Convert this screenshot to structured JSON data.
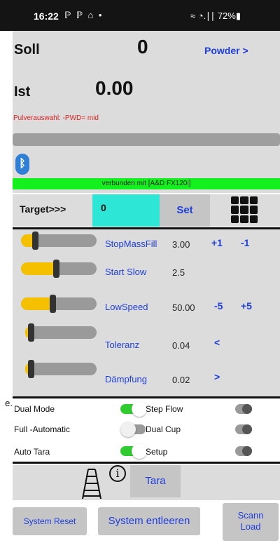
{
  "status_bar": {
    "time": "16:22",
    "notification_icons": "ℙ ℙ ⌂ •",
    "system": "≈ ◔.∣∣ 72%▮"
  },
  "header": {
    "soll_label": "Soll",
    "soll_value": "0",
    "powder_link": "Powder >",
    "ist_label": "Ist",
    "ist_value": "0.00",
    "pwd_text": "Pulverauswahl: -PWD= mid"
  },
  "progress": {
    "fraction": 0.0
  },
  "connection": {
    "bluetooth_glyph": "ᛒ",
    "status_text": "verbunden mit [A&D FX120i]"
  },
  "target": {
    "label": "Target>>>",
    "value": "0",
    "set_label": "Set"
  },
  "params": [
    {
      "name": "StopMassFill",
      "value": "3.00",
      "btn1": "+1",
      "btn2": "-1",
      "level": 0.1
    },
    {
      "name": "Start Slow",
      "value": "2.5",
      "btn1": "",
      "btn2": "",
      "level": 0.45
    },
    {
      "name": "LowSpeed",
      "value": "50.00",
      "btn1": "-5",
      "btn2": "+5",
      "level": 0.4
    },
    {
      "name": "Toleranz",
      "value": "0.04",
      "btn1": "<",
      "btn2": "",
      "level": 0.0
    },
    {
      "name": "Dämpfung",
      "value": "0.02",
      "btn1": ">",
      "btn2": "",
      "level": 0.0
    }
  ],
  "options": {
    "truncated_left": "e.",
    "dual_mode": "Dual Mode",
    "full_automatic": "Full  -Automatic",
    "auto_tara": "Auto Tara",
    "step_flow": "Step Flow",
    "dual_cup": "Dual Cup",
    "setup": "Setup"
  },
  "toggles": {
    "dual_mode": true,
    "full_automatic": false,
    "auto_tara": true,
    "step_flow": false,
    "dual_cup": false,
    "setup": false
  },
  "tools": {
    "info_glyph": "i",
    "tara_label": "Tara"
  },
  "footer": {
    "system_reset": "System Reset",
    "system_entleeren": "System entleeren",
    "scann_load": "Scann\nLoad"
  },
  "colors": {
    "accent_blue": "#1e3ee0",
    "cyan": "#2ee6d6",
    "connected_green": "#14f01e",
    "slider_yellow": "#f5c000",
    "warning_red": "#e02020"
  }
}
